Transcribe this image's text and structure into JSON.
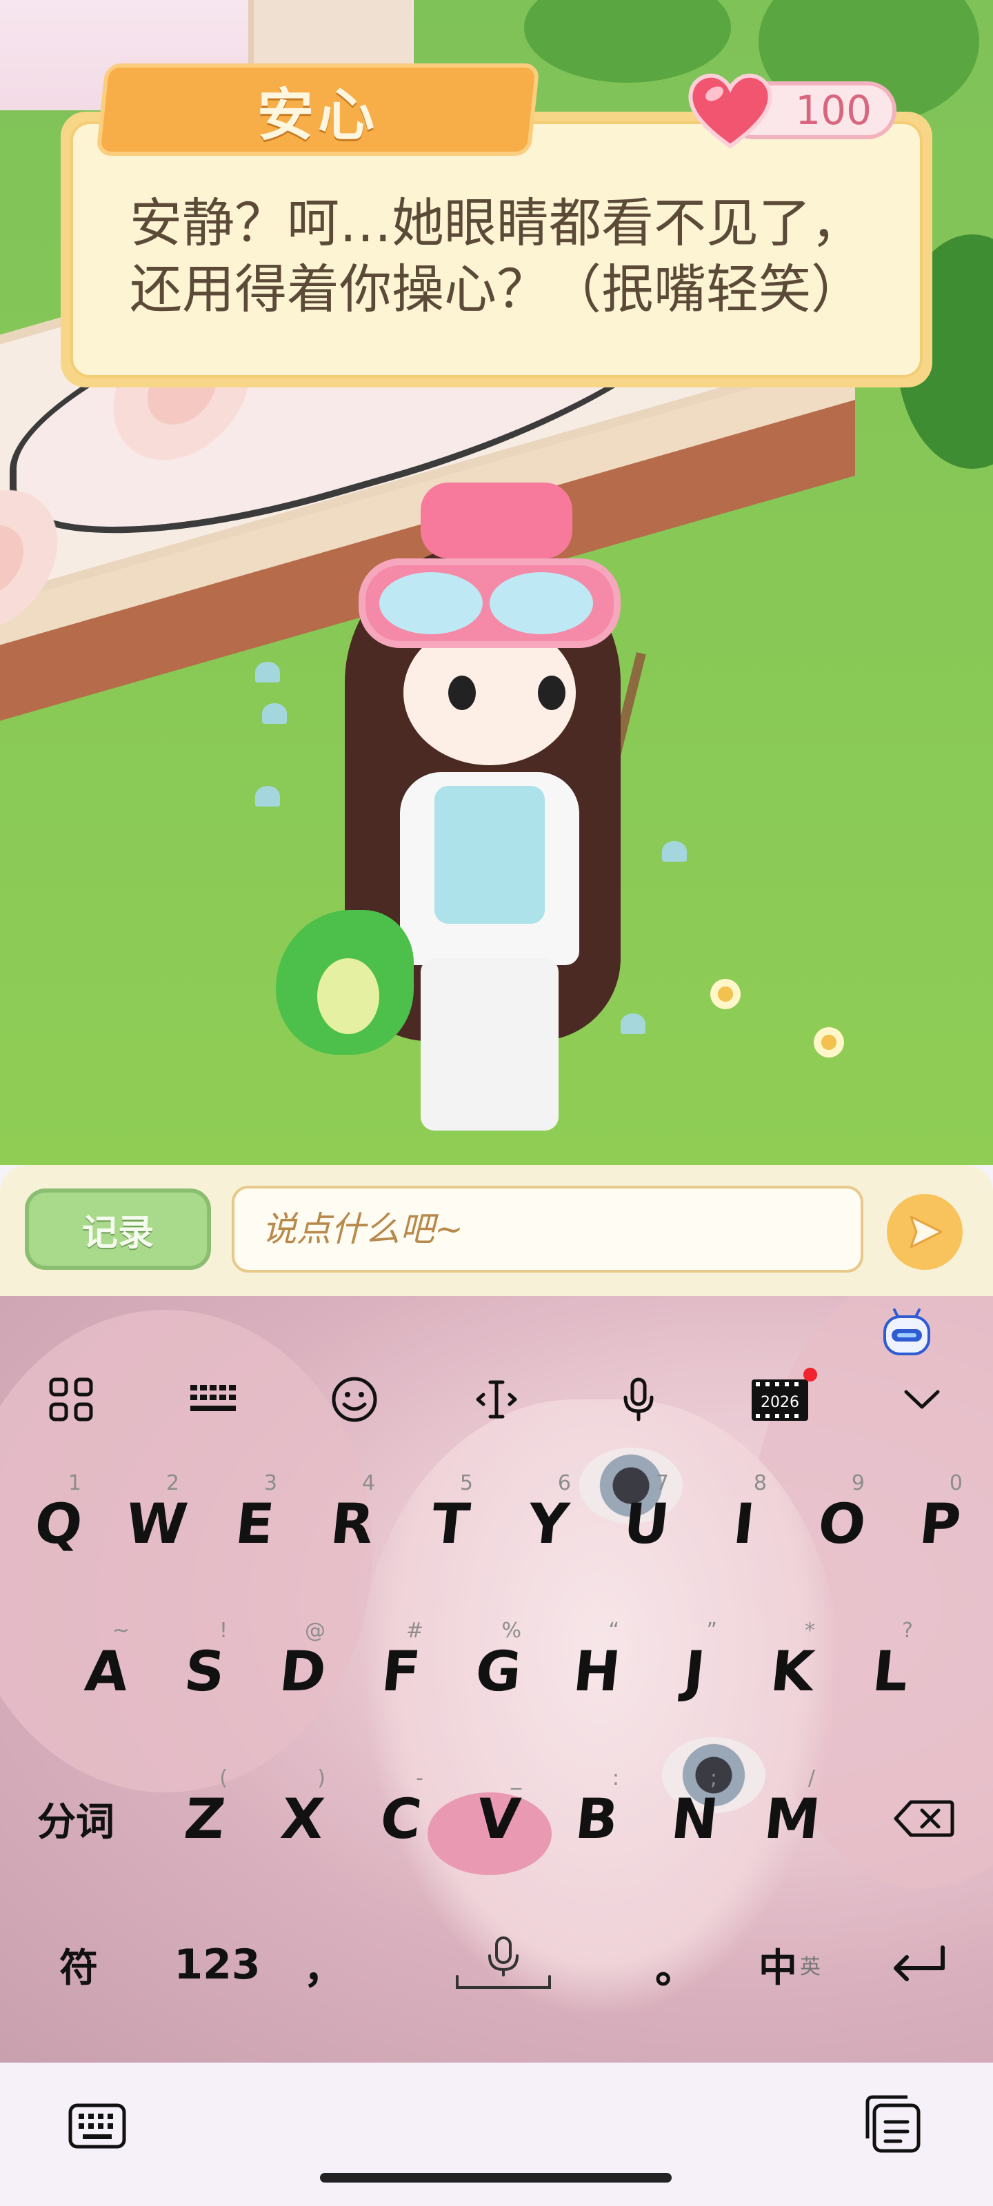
{
  "dialog": {
    "speaker": "安心",
    "affection": "100",
    "line": "安静？呵…她眼睛都看不见了，还用得着你操心？（抿嘴轻笑）"
  },
  "chat": {
    "record_label": "记录",
    "placeholder": "说点什么吧~"
  },
  "keyboard": {
    "toolbar": [
      "apps-grid-icon",
      "keyboard-layout-icon",
      "emoji-icon",
      "cursor-icon",
      "microphone-icon",
      "calendar-2026-icon",
      "collapse-icon"
    ],
    "calendar_year": "2026",
    "row1": [
      {
        "key": "Q",
        "hint": "1"
      },
      {
        "key": "W",
        "hint": "2"
      },
      {
        "key": "E",
        "hint": "3"
      },
      {
        "key": "R",
        "hint": "4"
      },
      {
        "key": "T",
        "hint": "5"
      },
      {
        "key": "Y",
        "hint": "6"
      },
      {
        "key": "U",
        "hint": "7"
      },
      {
        "key": "I",
        "hint": "8"
      },
      {
        "key": "O",
        "hint": "9"
      },
      {
        "key": "P",
        "hint": "0"
      }
    ],
    "row2": [
      {
        "key": "A",
        "hint": "~"
      },
      {
        "key": "S",
        "hint": "!"
      },
      {
        "key": "D",
        "hint": "@"
      },
      {
        "key": "F",
        "hint": "#"
      },
      {
        "key": "G",
        "hint": "%"
      },
      {
        "key": "H",
        "hint": "“"
      },
      {
        "key": "J",
        "hint": "”"
      },
      {
        "key": "K",
        "hint": "*"
      },
      {
        "key": "L",
        "hint": "?"
      }
    ],
    "row3": [
      {
        "key": "Z",
        "hint": "("
      },
      {
        "key": "X",
        "hint": ")"
      },
      {
        "key": "C",
        "hint": "-"
      },
      {
        "key": "V",
        "hint": "_"
      },
      {
        "key": "B",
        "hint": ":"
      },
      {
        "key": "N",
        "hint": ";"
      },
      {
        "key": "M",
        "hint": "/"
      }
    ],
    "segment_label": "分词",
    "symbols_label": "符",
    "numbers_label": "123",
    "comma": "，",
    "period": "。",
    "lang_main": "中",
    "lang_alt": "英"
  }
}
